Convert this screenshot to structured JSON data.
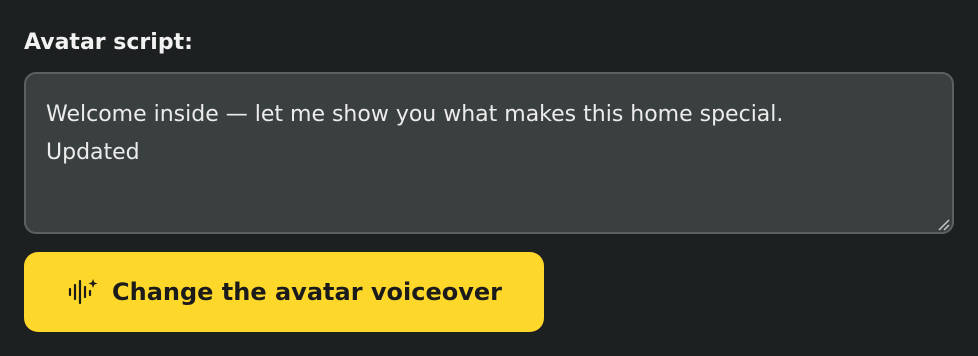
{
  "script_section": {
    "label": "Avatar script:",
    "value": "Welcome inside — let me show you what makes this home special.\nUpdated"
  },
  "cta_button": {
    "label": "Change the avatar voiceover",
    "icon": "voice-wave-sparkle-icon"
  },
  "colors": {
    "background": "#1d2021",
    "textarea_background": "#3a3f40",
    "button_background": "#fdd72a"
  }
}
